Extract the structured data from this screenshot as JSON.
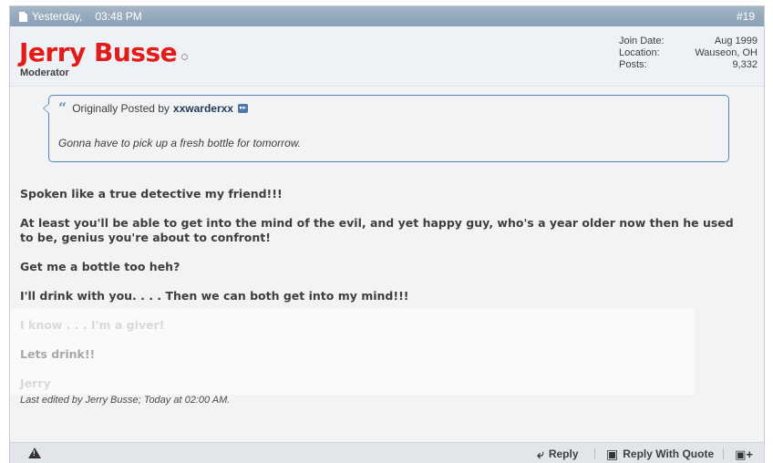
{
  "header": {
    "date": "Yesterday,",
    "time": "03:48 PM",
    "post_number": "#19"
  },
  "user": {
    "name": "Jerry Busse",
    "title": "Moderator",
    "stats": [
      {
        "label": "Join Date:",
        "value": "Aug 1999"
      },
      {
        "label": "Location:",
        "value": "Wauseon, OH"
      },
      {
        "label": "Posts:",
        "value": "9,332"
      }
    ]
  },
  "quote": {
    "prefix": "Originally Posted by",
    "author": "xxwarderxx",
    "text": "Gonna have to pick up a fresh bottle for tomorrow."
  },
  "message": {
    "p1": "Spoken like a true detective my friend!!!",
    "p2": "At least you'll be able to get into the mind of the evil, and yet happy guy, who's a year older now then he used to be, genius you're about to confront!",
    "p3": "Get me a bottle too heh?",
    "p4": "I'll drink with you. . . . Then we can both get into my mind!!!",
    "p5": "I know . . . I'm a giver!",
    "p6": "Lets drink!!",
    "p7": "Jerry"
  },
  "last_edited": "Last edited by Jerry Busse; Today at 02:00 AM.",
  "footer": {
    "reply_label": "Reply",
    "reply_with_quote_label": "Reply With Quote"
  },
  "colors": {
    "username": "#e31c18",
    "header_bg": "#8aa0b4",
    "quote_border": "#4e87bc"
  },
  "icons": [
    "document-icon",
    "online-status-icon",
    "quote-icon",
    "view-post-icon",
    "report-icon",
    "reply-icon",
    "reply-with-quote-icon",
    "multi-quote-icon"
  ]
}
